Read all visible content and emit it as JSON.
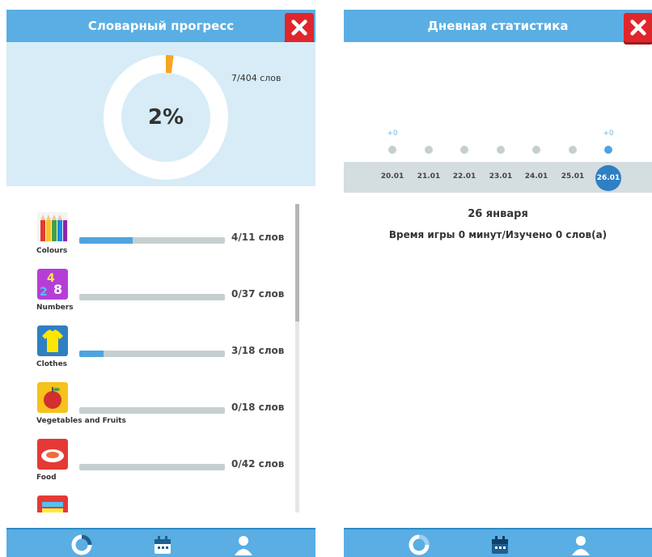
{
  "left": {
    "title": "Словарный прогресс",
    "percent": "2%",
    "progress_fraction": 0.02,
    "total_words": "7/404 слов",
    "categories": [
      {
        "name": "Colours",
        "count": "4/11 слов",
        "fraction": 0.364,
        "icon": "pencils-icon"
      },
      {
        "name": "Numbers",
        "count": "0/37 слов",
        "fraction": 0,
        "icon": "numbers-icon"
      },
      {
        "name": "Clothes",
        "count": "3/18 слов",
        "fraction": 0.167,
        "icon": "tshirt-icon"
      },
      {
        "name": "Vegetables and Fruits",
        "count": "0/18 слов",
        "fraction": 0,
        "icon": "apple-icon"
      },
      {
        "name": "Food",
        "count": "0/42 слов",
        "fraction": 0,
        "icon": "plate-icon"
      }
    ]
  },
  "right": {
    "title": "Дневная статистика",
    "days": [
      {
        "date": "20.01",
        "plus": "+0",
        "active": false
      },
      {
        "date": "21.01",
        "plus": "",
        "active": false
      },
      {
        "date": "22.01",
        "plus": "",
        "active": false
      },
      {
        "date": "23.01",
        "plus": "",
        "active": false
      },
      {
        "date": "24.01",
        "plus": "",
        "active": false
      },
      {
        "date": "25.01",
        "plus": "",
        "active": false
      },
      {
        "date": "26.01",
        "plus": "+0",
        "active": true
      }
    ],
    "selected_date": "26 января",
    "play_info": "Время игры 0 минут/Изучено 0 слов(а)"
  },
  "colors": {
    "header": "#5aaee3",
    "accent": "#4fa3df",
    "donut_progress": "#f5a623",
    "close": "#e0262b"
  },
  "nav_icons": [
    "progress-icon",
    "calendar-icon",
    "profile-icon"
  ]
}
